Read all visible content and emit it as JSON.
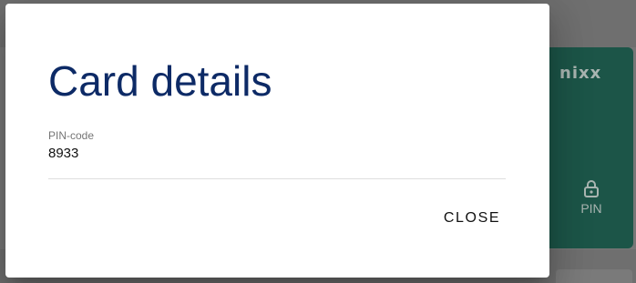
{
  "dialog": {
    "title": "Card details",
    "pin_field": {
      "label": "PIN-code",
      "value": "8933"
    },
    "close_label": "CLOSE"
  },
  "background_card": {
    "brand": "nixx",
    "pin_label": "PIN",
    "lock_icon": "lock-icon",
    "color": "#1c5548"
  },
  "colors": {
    "title": "#0d2a66",
    "overlay": "#6f6f6f"
  }
}
